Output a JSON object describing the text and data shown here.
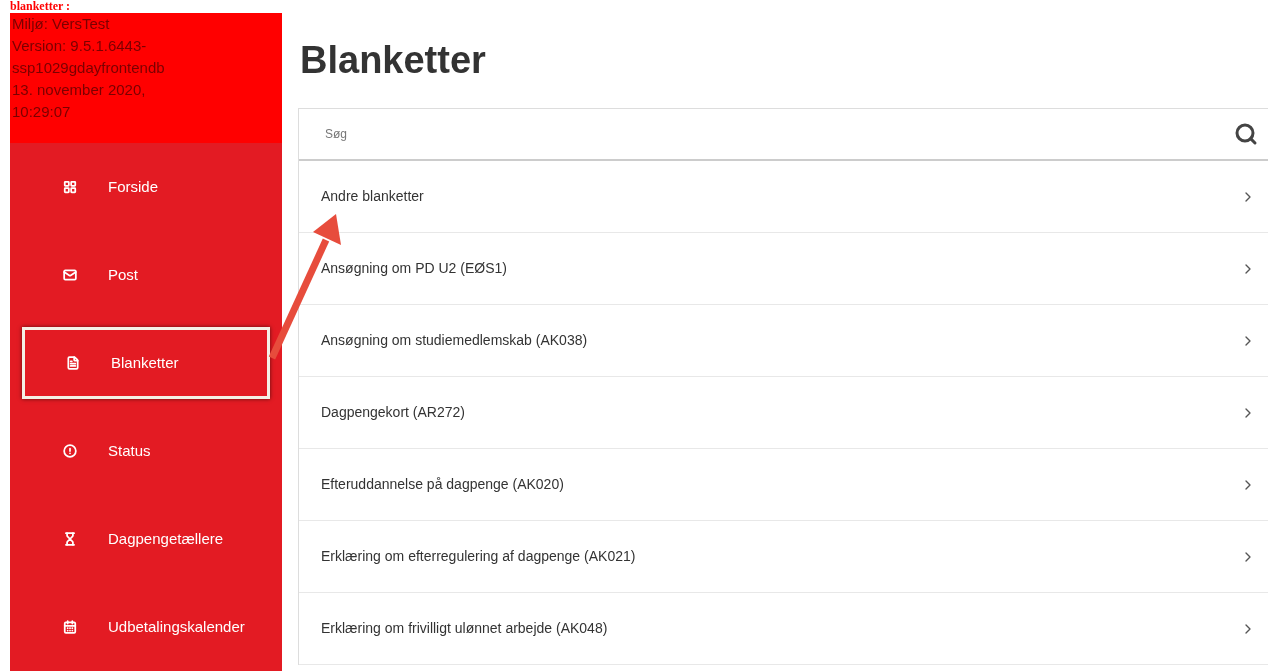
{
  "caption": "blanketter :",
  "environment": {
    "lines": [
      "Miljø: VersTest",
      "Version: 9.5.1.6443-",
      "ssp1029gdayfrontendb",
      "13. november 2020,",
      "10:29:07"
    ]
  },
  "sidebar": {
    "items": [
      {
        "label": "Forside",
        "selected": false
      },
      {
        "label": "Post",
        "selected": false
      },
      {
        "label": "Blanketter",
        "selected": true
      },
      {
        "label": "Status",
        "selected": false
      },
      {
        "label": "Dagpengetællere",
        "selected": false
      },
      {
        "label": "Udbetalingskalender",
        "selected": false
      }
    ]
  },
  "page": {
    "title": "Blanketter",
    "search": {
      "placeholder": "Søg"
    },
    "forms": [
      "Andre blanketter",
      "Ansøgning om PD U2 (EØS1)",
      "Ansøgning om studiemedlemskab (AK038)",
      "Dagpengekort (AR272)",
      "Efteruddannelse på dagpenge (AK020)",
      "Erklæring om efterregulering af dagpenge (AK021)",
      "Erklæring om frivilligt ulønnet arbejde (AK048)"
    ]
  }
}
